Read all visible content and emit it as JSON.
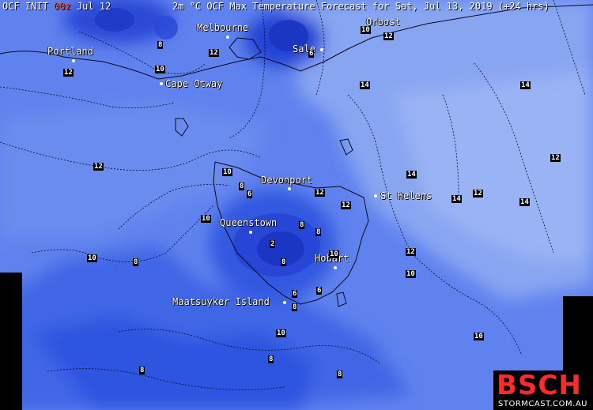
{
  "header": {
    "left_prefix": "OCF INIT ",
    "init_hour": "00z",
    "left_suffix": " Jul 12",
    "title": "2m °C OCF Max Temperature Forecast for Sat, Jul 13, 2019 (+24 hrs)"
  },
  "places": [
    {
      "id": "melbourne",
      "name": "Melbourne"
    },
    {
      "id": "orbost",
      "name": "Orbost"
    },
    {
      "id": "portland",
      "name": "Portland"
    },
    {
      "id": "sale",
      "name": "Sale"
    },
    {
      "id": "cape-otway",
      "name": "Cape Otway"
    },
    {
      "id": "devonport",
      "name": "Devonport"
    },
    {
      "id": "st-helens",
      "name": "St Helens"
    },
    {
      "id": "queenstown",
      "name": "Queenstown"
    },
    {
      "id": "hobart",
      "name": "Hobart"
    },
    {
      "id": "maatsuyker-island",
      "name": "Maatsuyker Island"
    }
  ],
  "contour_labels": [
    "10",
    "12",
    "8",
    "10",
    "12",
    "6",
    "12",
    "14",
    "14",
    "12",
    "12",
    "14",
    "10",
    "8",
    "6",
    "10",
    "12",
    "14",
    "12",
    "14",
    "10",
    "8",
    "2",
    "10",
    "6",
    "12",
    "8",
    "10",
    "6",
    "8",
    "10",
    "10",
    "8",
    "8",
    "8",
    "8",
    "8",
    "12"
  ],
  "colors": {
    "sea_light": "#7f9df2",
    "mid": "#5a7ff0",
    "cold": "#3658e6",
    "colder": "#2342d8",
    "coldest": "#1836c8",
    "logo_red": "#ff2a2a"
  },
  "logo": {
    "main": "BSCH",
    "sub": "STORMCAST.COM.AU"
  }
}
